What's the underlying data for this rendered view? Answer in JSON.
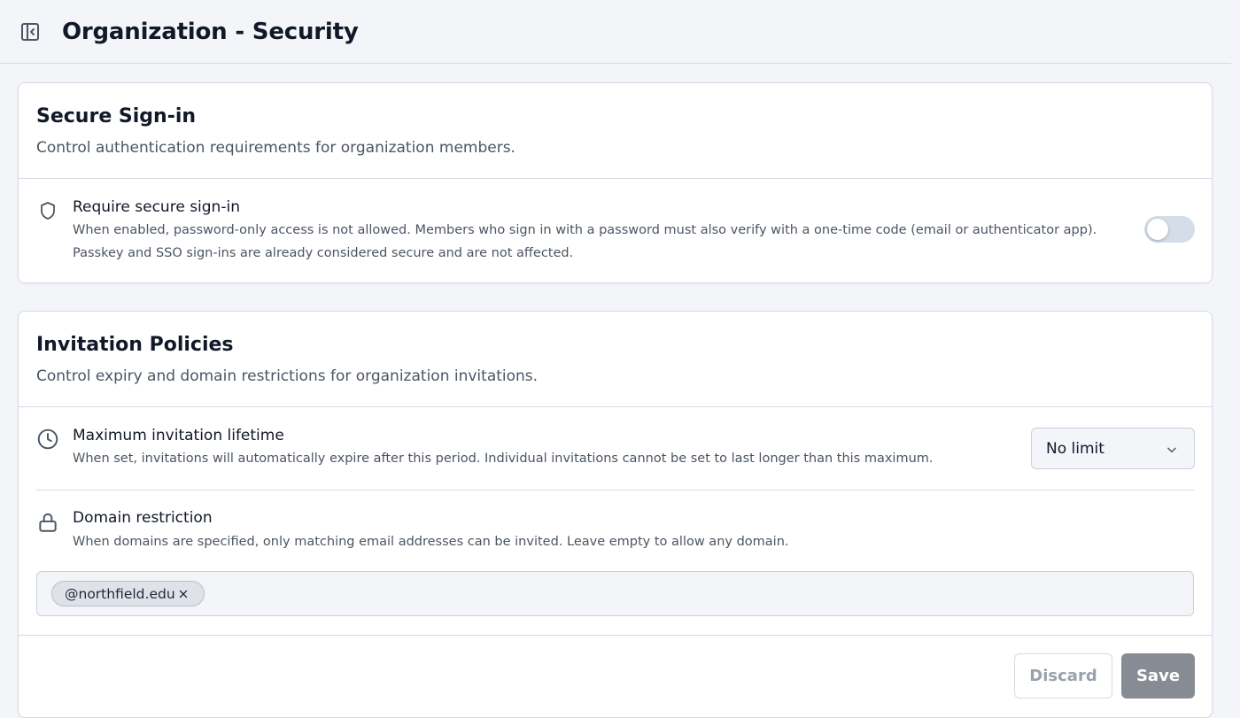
{
  "header": {
    "title": "Organization - Security",
    "toggle_icon": "sidebar-collapse-icon"
  },
  "secure_signin": {
    "title": "Secure Sign-in",
    "description": "Control authentication requirements for organization members.",
    "setting": {
      "icon": "shield-icon",
      "title": "Require secure sign-in",
      "description_line1": "When enabled, password-only access is not allowed. Members who sign in with a password must also verify with a one-time code (email or authenticator app).",
      "description_line2": "Passkey and SSO sign-ins are already considered secure and are not affected.",
      "enabled": false
    }
  },
  "invitation_policies": {
    "title": "Invitation Policies",
    "description": "Control expiry and domain restrictions for organization invitations.",
    "lifetime": {
      "icon": "clock-icon",
      "title": "Maximum invitation lifetime",
      "description": "When set, invitations will automatically expire after this period. Individual invitations cannot be set to last longer than this maximum.",
      "selected": "No limit"
    },
    "domain": {
      "icon": "lock-icon",
      "title": "Domain restriction",
      "description": "When domains are specified, only matching email addresses can be invited. Leave empty to allow any domain.",
      "tags": [
        "@northfield.edu"
      ]
    },
    "actions": {
      "discard_label": "Discard",
      "save_label": "Save"
    }
  },
  "colors": {
    "background": "#f3f5f9",
    "card": "#ffffff",
    "border": "#d5dbe4",
    "save_button": "#878c94",
    "toggle_off": "#d5dde8"
  }
}
